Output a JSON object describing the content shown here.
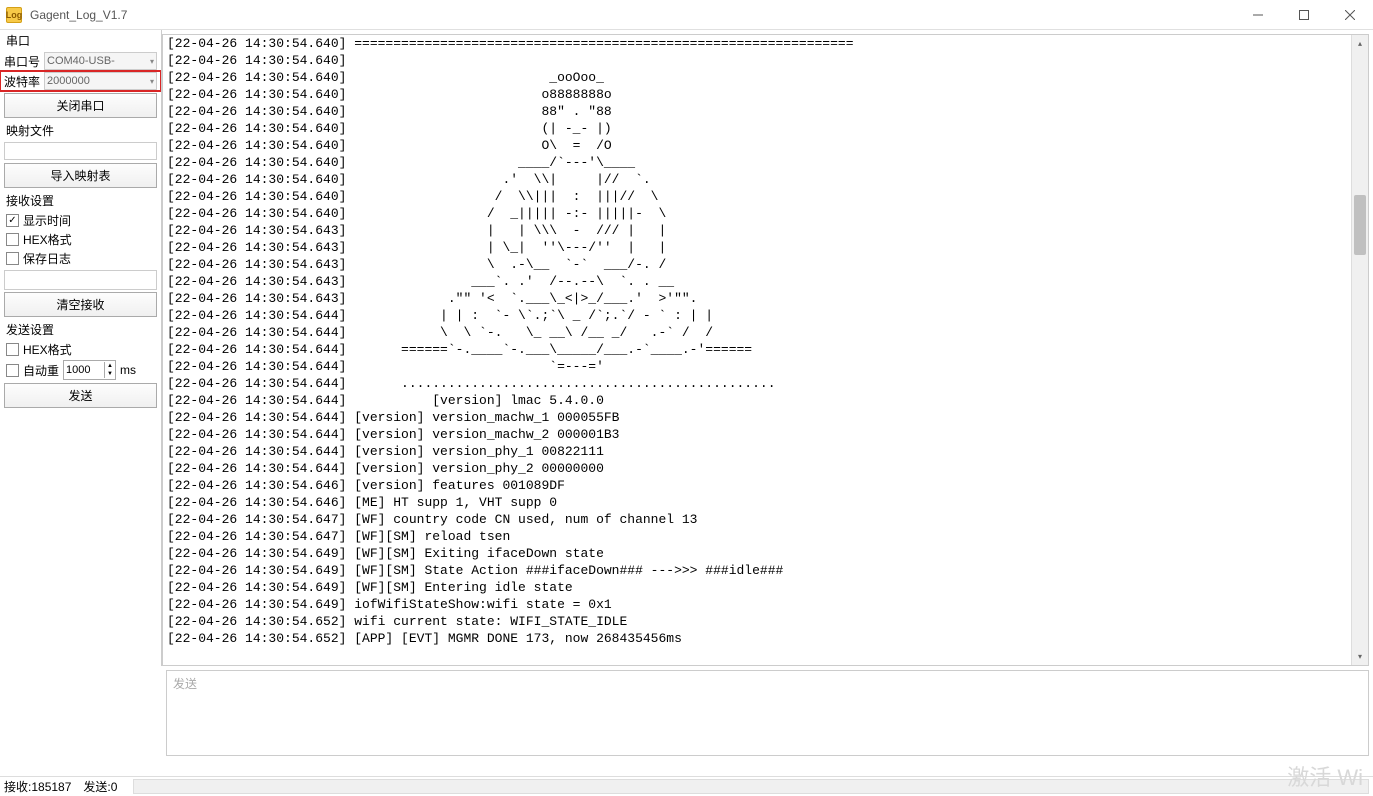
{
  "window": {
    "title": "Gagent_Log_V1.7",
    "icon_text": "Log"
  },
  "sidebar": {
    "serial_group": "串口",
    "port_label": "串口号",
    "port_value": "COM40-USB-",
    "baud_label": "波特率",
    "baud_value": "2000000",
    "close_port": "关闭串口",
    "map_file_label": "映射文件",
    "map_file_value": "",
    "import_map": "导入映射表",
    "recv_group": "接收设置",
    "show_time": "显示时间",
    "hex_format": "HEX格式",
    "save_log": "保存日志",
    "clear_recv": "清空接收",
    "send_group": "发送设置",
    "hex_format2": "HEX格式",
    "auto_send": "自动重",
    "interval_value": "1000",
    "interval_unit": "ms",
    "send_btn": "发送"
  },
  "log_lines": [
    "[22-04-26 14:30:54.640] ================================================================",
    "[22-04-26 14:30:54.640] ",
    "[22-04-26 14:30:54.640]                          _ooOoo_",
    "[22-04-26 14:30:54.640]                         o8888888o",
    "[22-04-26 14:30:54.640]                         88\" . \"88",
    "[22-04-26 14:30:54.640]                         (| -_- |)",
    "[22-04-26 14:30:54.640]                         O\\  =  /O",
    "[22-04-26 14:30:54.640]                      ____/`---'\\____",
    "[22-04-26 14:30:54.640]                    .'  \\\\|     |//  `.",
    "[22-04-26 14:30:54.640]                   /  \\\\|||  :  |||//  \\",
    "[22-04-26 14:30:54.640]                  /  _||||| -:- |||||-  \\",
    "[22-04-26 14:30:54.643]                  |   | \\\\\\  -  /// |   |",
    "[22-04-26 14:30:54.643]                  | \\_|  ''\\---/''  |   |",
    "[22-04-26 14:30:54.643]                  \\  .-\\__  `-`  ___/-. /",
    "[22-04-26 14:30:54.643]                ___`. .'  /--.--\\  `. . __",
    "[22-04-26 14:30:54.643]             .\"\" '<  `.___\\_<|>_/___.'  >'\"\".",
    "[22-04-26 14:30:54.644]            | | :  `- \\`.;`\\ _ /`;.`/ - ` : | |",
    "[22-04-26 14:30:54.644]            \\  \\ `-.   \\_ __\\ /__ _/   .-` /  /",
    "[22-04-26 14:30:54.644]       ======`-.____`-.___\\_____/___.-`____.-'======",
    "[22-04-26 14:30:54.644]                          `=---='",
    "[22-04-26 14:30:54.644]       ................................................",
    "[22-04-26 14:30:54.644]           [version] lmac 5.4.0.0",
    "[22-04-26 14:30:54.644] [version] version_machw_1 000055FB",
    "[22-04-26 14:30:54.644] [version] version_machw_2 000001B3",
    "[22-04-26 14:30:54.644] [version] version_phy_1 00822111",
    "[22-04-26 14:30:54.644] [version] version_phy_2 00000000",
    "[22-04-26 14:30:54.646] [version] features 001089DF",
    "[22-04-26 14:30:54.646] [ME] HT supp 1, VHT supp 0",
    "[22-04-26 14:30:54.647] [WF] country code CN used, num of channel 13",
    "[22-04-26 14:30:54.647] [WF][SM] reload tsen",
    "[22-04-26 14:30:54.649] [WF][SM] Exiting ifaceDown state",
    "[22-04-26 14:30:54.649] [WF][SM] State Action ###ifaceDown### --->>> ###idle###",
    "[22-04-26 14:30:54.649] [WF][SM] Entering idle state",
    "[22-04-26 14:30:54.649] iofWifiStateShow:wifi state = 0x1",
    "[22-04-26 14:30:54.652] wifi current state: WIFI_STATE_IDLE",
    "[22-04-26 14:30:54.652] [APP] [EVT] MGMR DONE 173, now 268435456ms"
  ],
  "send_placeholder": "发送",
  "status": {
    "recv_label": "接收:",
    "recv_count": "185187",
    "send_label": "发送:",
    "send_count": "0"
  },
  "watermark": "激活 Wi"
}
